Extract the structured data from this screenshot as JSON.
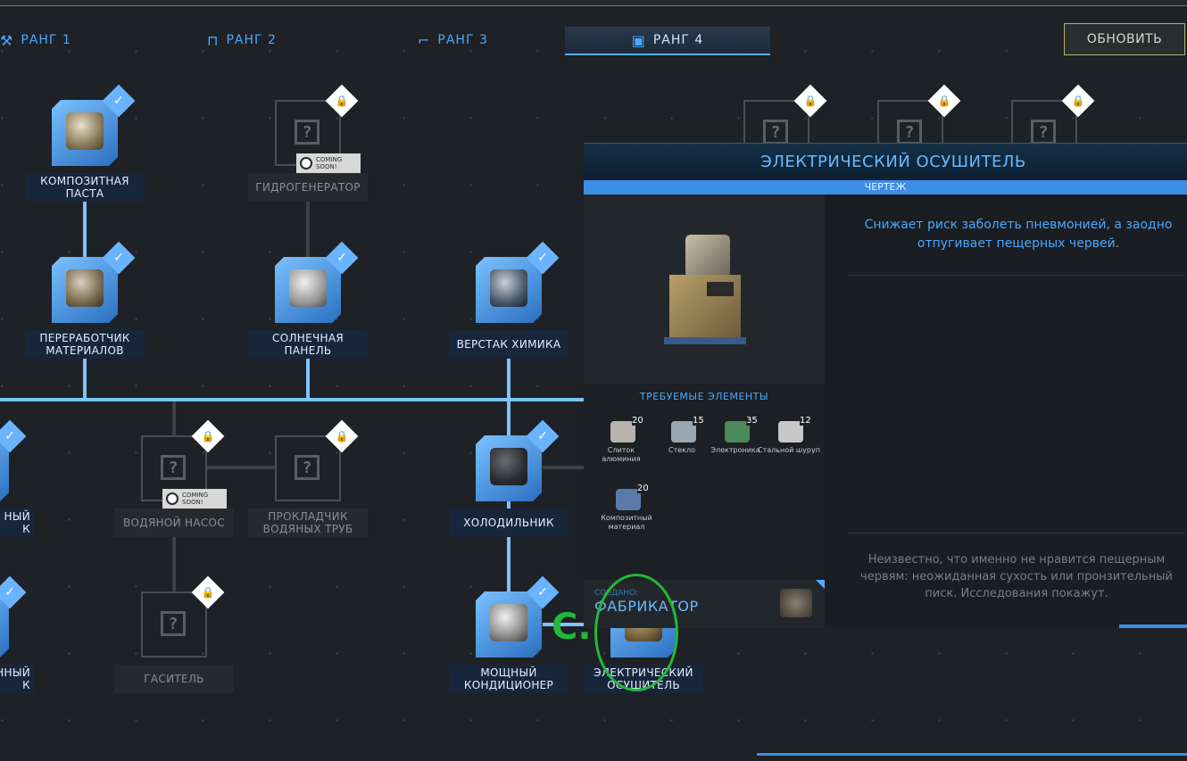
{
  "tabs": [
    {
      "label": "РАНГ 1",
      "icon": "wrench-icon"
    },
    {
      "label": "РАНГ 2",
      "icon": "bridge-icon"
    },
    {
      "label": "РАНГ 3",
      "icon": "crane-icon"
    },
    {
      "label": "РАНГ 4",
      "icon": "toolbox-icon",
      "active": true
    }
  ],
  "refresh_label": "ОБНОВИТЬ",
  "coming_soon": "COMING SOON!",
  "nodes": {
    "paste": "КОМПОЗИТНАЯ ПАСТА",
    "hydro": "ГИДРОГЕНЕРАТОР",
    "recycler": "ПЕРЕРАБОТЧИК МАТЕРИАЛОВ",
    "solar": "СОЛНЕЧНАЯ ПАНЕЛЬ",
    "chem": "ВЕРСТАК ХИМИКА",
    "left1": "НЫЙ",
    "left1b": "К",
    "pump": "ВОДЯНОЙ НАСОС",
    "pipes": "ПРОКЛАДЧИК ВОДЯНЫХ ТРУБ",
    "fridge": "ХОЛОДИЛЬНИК",
    "left2": "ННЫЙ",
    "left2b": "К",
    "damper": "ГАСИТЕЛЬ",
    "ac": "МОЩНЫЙ КОНДИЦИОНЕР",
    "dehum": "ЭЛЕКТРИЧЕСКИЙ ОСУШИТЕЛЬ"
  },
  "panel": {
    "title": "ЭЛЕКТРИЧЕСКИЙ ОСУШИТЕЛЬ",
    "subtitle": "ЧЕРТЕЖ",
    "description": "Снижает риск заболеть пневмонией, а заодно отпугивает пещерных червей.",
    "required_title": "ТРЕБУЕМЫЕ ЭЛЕМЕНТЫ",
    "items": [
      {
        "name": "Слиток алюминия",
        "qty": "20",
        "color": "#b8b4ac"
      },
      {
        "name": "Стекло",
        "qty": "15",
        "color": "#9aa6b0"
      },
      {
        "name": "Электроника",
        "qty": "35",
        "color": "#4a8a5a"
      },
      {
        "name": "Стальной шуруп",
        "qty": "12",
        "color": "#c8c8c8"
      },
      {
        "name": "Композитный материал",
        "qty": "20",
        "color": "#5a7aa8"
      }
    ],
    "lore": "Неизвестно, что именно не нравится пещерным червям: неожиданная сухость или пронзительный писк. Исследования покажут.",
    "created_label": "СОЗДАНО:",
    "created_value": "ФАБРИКАТОР"
  },
  "annotation": {
    "letter": "C.",
    "color": "#22b838"
  }
}
